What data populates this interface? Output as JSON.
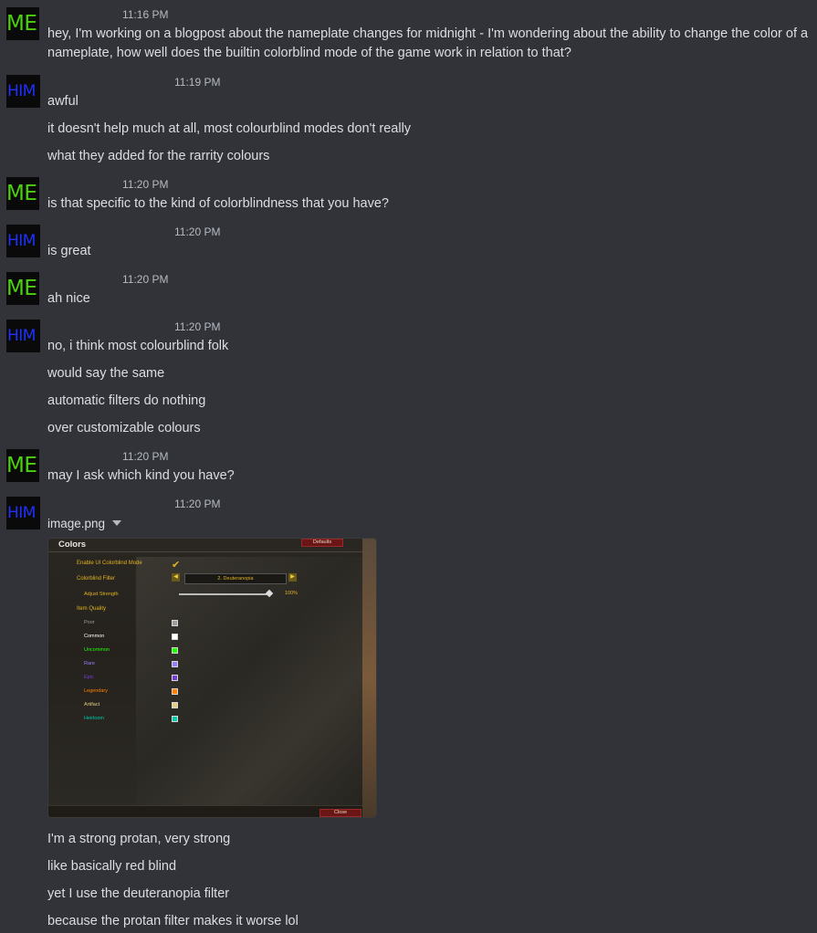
{
  "avatars": {
    "me": "ME",
    "him": "HIM"
  },
  "groups": [
    {
      "time": "11:16 PM",
      "lines": [
        "hey, I'm working on a blogpost about the nameplate changes for midnight - I'm wondering about the ability to change the color of a nameplate, how well does the builtin colorblind mode of the game work in relation to that?"
      ]
    },
    {
      "time": "11:19 PM",
      "lines": [
        "awful",
        "it doesn't help much at all, most colourblind modes don't really",
        "what they added for the rarrity colours"
      ]
    },
    {
      "time": "11:20 PM",
      "lines": [
        "is that specific to the kind of colorblindness that you have?"
      ]
    },
    {
      "time": "11:20 PM",
      "lines": [
        "is great"
      ]
    },
    {
      "time": "11:20 PM",
      "lines": [
        "ah nice"
      ]
    },
    {
      "time": "11:20 PM",
      "lines": [
        "no, i think most colourblind folk",
        "would say the same",
        "automatic filters do nothing",
        "over customizable colours"
      ]
    },
    {
      "time": "11:20 PM",
      "lines": [
        "may I ask which kind you have?"
      ]
    },
    {
      "time": "11:20 PM",
      "attachment": "image.png",
      "lines": [
        "I'm a strong protan, very strong",
        "like basically red blind",
        "yet I use the deuteranopia filter",
        "because the protan filter makes it worse lol"
      ]
    }
  ],
  "screenshot": {
    "title": "Colors",
    "defaults": "Defaults",
    "close": "Close",
    "enable_label": "Enable UI Colorblind Mode",
    "filter_label": "Colorblind Filter",
    "filter_value": "2. Deuteranopia",
    "strength_label": "Adjust Strength",
    "strength_value": "100%",
    "strength_level": 1.0,
    "item_quality_label": "Item Quality",
    "qualities": [
      {
        "label": "Poor",
        "color": "#9d9d9d"
      },
      {
        "label": "Common",
        "color": "#ffffff"
      },
      {
        "label": "Uncommon",
        "color": "#1eff00"
      },
      {
        "label": "Rare",
        "color": "#9a7dff"
      },
      {
        "label": "Epic",
        "color": "#7a3ad6"
      },
      {
        "label": "Legendary",
        "color": "#ff8000"
      },
      {
        "label": "Artifact",
        "color": "#e6cc80"
      },
      {
        "label": "Heirloom",
        "color": "#00ccaa"
      }
    ]
  },
  "colors": {
    "background": "#313338",
    "me_avatar": "#4bd20c",
    "him_avatar": "#2030ff",
    "text": "#dbdee1",
    "timestamp": "#b5bac1"
  }
}
